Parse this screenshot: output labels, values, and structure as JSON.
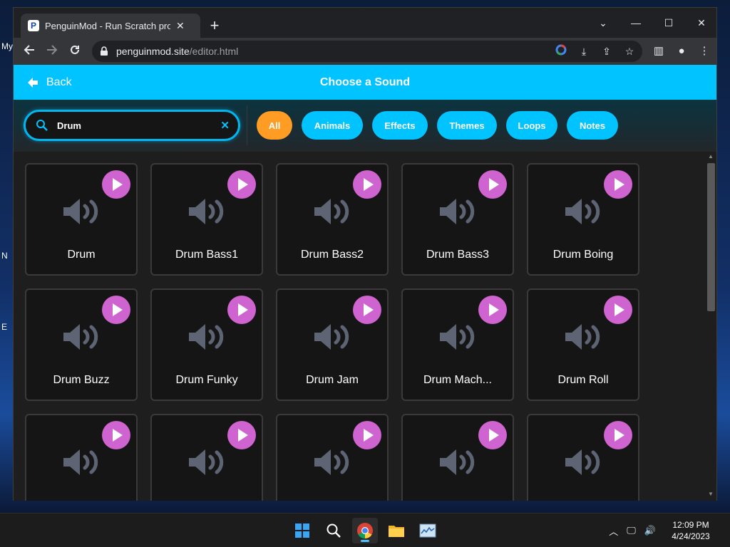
{
  "desktop": {
    "fragments": [
      "My",
      "N",
      "E"
    ]
  },
  "browser": {
    "tab_title": "PenguinMod - Run Scratch proje",
    "url_host": "penguinmod.site",
    "url_path": "/editor.html"
  },
  "app": {
    "back_label": "Back",
    "title": "Choose a Sound",
    "search": {
      "value": "Drum",
      "placeholder": "Search"
    },
    "filters": [
      "All",
      "Animals",
      "Effects",
      "Themes",
      "Loops",
      "Notes"
    ],
    "active_filter": "All",
    "sounds": [
      {
        "name": "Drum"
      },
      {
        "name": "Drum Bass1"
      },
      {
        "name": "Drum Bass2"
      },
      {
        "name": "Drum Bass3"
      },
      {
        "name": "Drum Boing"
      },
      {
        "name": "Drum Buzz"
      },
      {
        "name": "Drum Funky"
      },
      {
        "name": "Drum Jam"
      },
      {
        "name": "Drum Mach..."
      },
      {
        "name": "Drum Roll"
      },
      {
        "name": ""
      },
      {
        "name": ""
      },
      {
        "name": ""
      },
      {
        "name": ""
      },
      {
        "name": ""
      }
    ],
    "colors": {
      "header": "#00c3ff",
      "active_pill": "#ff9c23",
      "play_button": "#cf63cf"
    }
  },
  "taskbar": {
    "time": "12:09 PM",
    "date": "4/24/2023"
  }
}
